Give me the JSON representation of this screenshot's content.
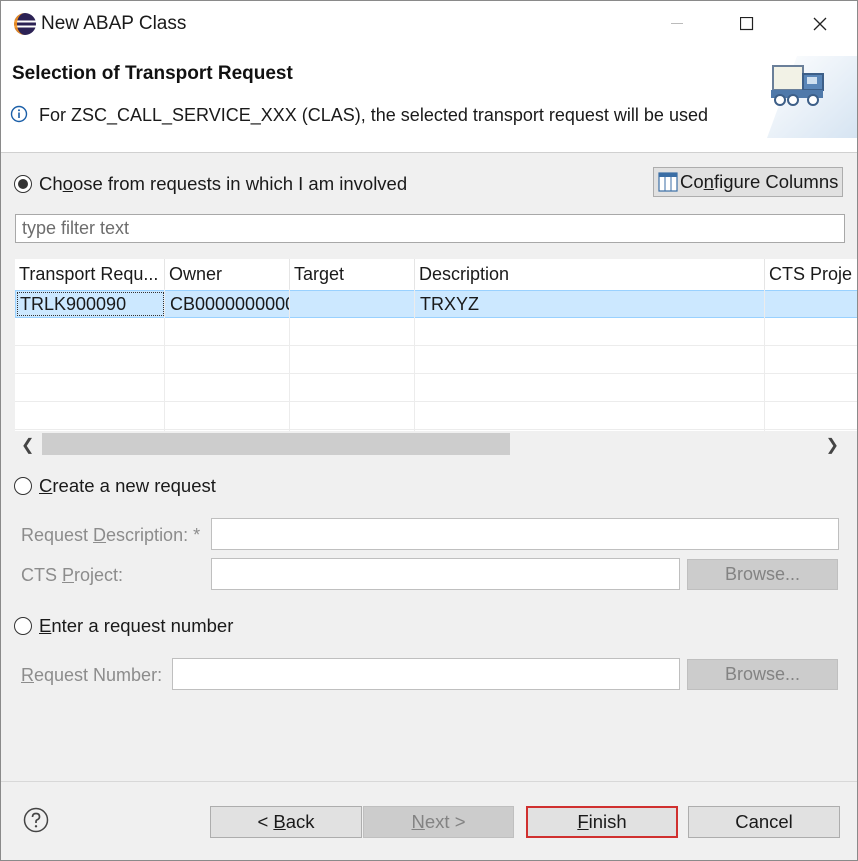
{
  "window": {
    "title": "New ABAP Class"
  },
  "header": {
    "title": "Selection of Transport Request",
    "info": "For ZSC_CALL_SERVICE_XXX (CLAS), the selected transport request will be used"
  },
  "options": {
    "choose": {
      "pre": "Ch",
      "accel": "o",
      "post": "ose from requests in which I am involved",
      "selected": true
    },
    "create": {
      "accel": "C",
      "post": "reate a new request",
      "selected": false
    },
    "enter": {
      "accel": "E",
      "post": "nter a request number",
      "selected": false
    }
  },
  "configure": {
    "pre": "Co",
    "accel": "n",
    "post": "figure Columns"
  },
  "filter": {
    "placeholder": "type filter text"
  },
  "table": {
    "columns": [
      "Transport Requ...",
      "Owner",
      "Target",
      "Description",
      "CTS Proje"
    ],
    "rows": [
      {
        "request": "TRLK900090",
        "owner": "CB0000000000...",
        "target": "",
        "description": "TRXYZ",
        "cts": ""
      }
    ]
  },
  "create_fields": {
    "desc_label": {
      "pre": "Request ",
      "accel": "D",
      "post": "escription: *"
    },
    "cts_label": {
      "pre": "CTS ",
      "accel": "P",
      "post": "roject:"
    },
    "browse": "Browse..."
  },
  "enter_fields": {
    "number_label": {
      "pre": "",
      "accel": "R",
      "post": "equest Number:"
    },
    "browse": "Browse..."
  },
  "footer": {
    "back": {
      "pre": "< ",
      "accel": "B",
      "post": "ack"
    },
    "next": {
      "accel": "N",
      "post": "ext >"
    },
    "finish": {
      "accel": "F",
      "post": "inish"
    },
    "cancel": "Cancel"
  }
}
